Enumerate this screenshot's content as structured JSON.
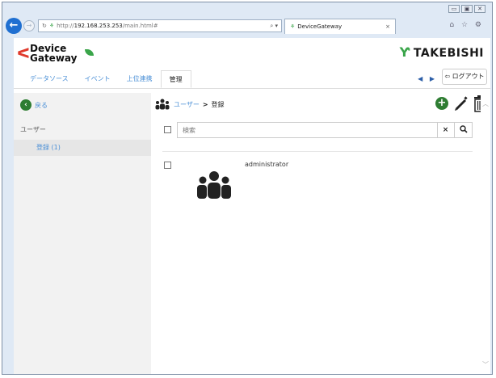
{
  "browser": {
    "window_controls": [
      "▭",
      "▣",
      "✕"
    ],
    "address": {
      "protocol": "http://",
      "host": "192.168.253.253",
      "path": "/main.html#",
      "tools": "⌕ ▾"
    },
    "tab_title": "DeviceGateway",
    "tab_close": "×",
    "right_icons": "⌂ ☆ ⚙"
  },
  "app": {
    "logo_line1": "Device",
    "logo_line2": "Gateway",
    "brand": "TAKEBISHI",
    "menu": [
      {
        "label": "データソース"
      },
      {
        "label": "イベント"
      },
      {
        "label": "上位連携"
      },
      {
        "label": "管理"
      }
    ],
    "scroll_arrows": "◀ ▶",
    "logout_label": "ログアウト"
  },
  "sidebar": {
    "back_label": "戻る",
    "section_label": "ユーザー",
    "item_label": "登録 (1)"
  },
  "main": {
    "breadcrumb": {
      "link": "ユーザー",
      "sep": ">",
      "current": "登録"
    },
    "search_placeholder": "検索",
    "search_clear": "×",
    "users": [
      {
        "name": "administrator"
      }
    ]
  },
  "colors": {
    "link": "#4a8fd6",
    "green": "#2e7d32",
    "brand_red": "#e03a2c",
    "browser_blue": "#1f6fd1"
  }
}
